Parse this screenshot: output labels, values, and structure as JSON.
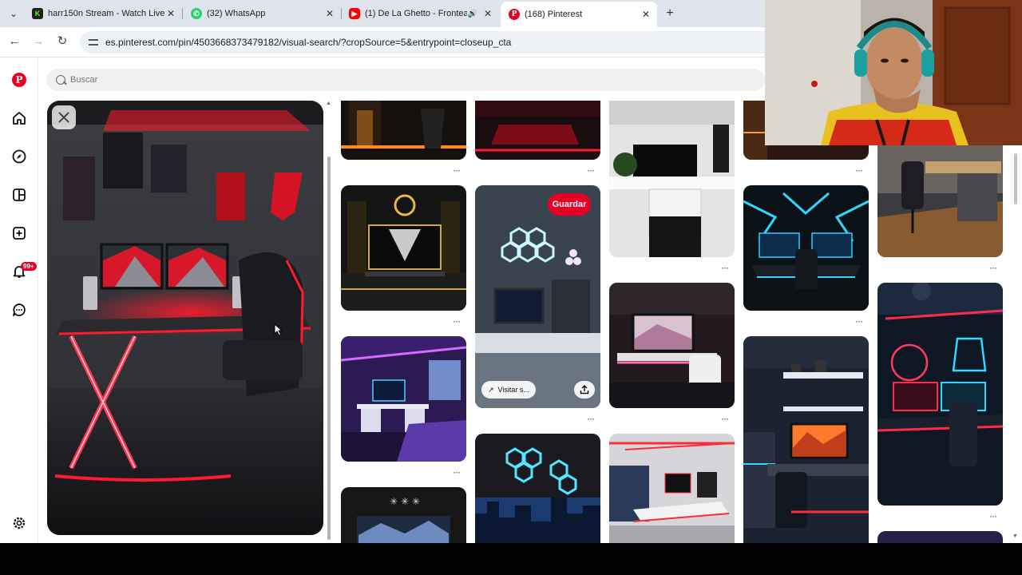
{
  "browser": {
    "tabs": [
      {
        "title": "harr150n Stream - Watch Live o",
        "favicon": "kick-icon",
        "active": false
      },
      {
        "title": "(32) WhatsApp",
        "favicon": "whatsapp-icon",
        "active": false
      },
      {
        "title": "(1) De La Ghetto - Frontean",
        "favicon": "youtube-icon",
        "active": false,
        "audio": true
      },
      {
        "title": "(168) Pinterest",
        "favicon": "pinterest-icon",
        "active": true
      }
    ],
    "close_glyph": "✕",
    "new_tab_glyph": "+",
    "url": "es.pinterest.com/pin/4503668373479182/visual-search/?cropSource=5&entrypoint=closeup_cta"
  },
  "sidebar": {
    "items": [
      "pinterest-logo",
      "home-icon",
      "explore-icon",
      "boards-icon",
      "create-icon",
      "notifications-icon",
      "messages-icon",
      "settings-icon"
    ],
    "notification_badge": "99+"
  },
  "search": {
    "placeholder": "Buscar"
  },
  "hovered_pin": {
    "save_label": "Guardar",
    "visit_label": "Visitar s..."
  },
  "more_glyph": "···",
  "colors": {
    "brand": "#e60023",
    "accent_red": "#ff1a2e",
    "accent_cyan": "#21d4ff",
    "accent_purple": "#8a4dff"
  }
}
